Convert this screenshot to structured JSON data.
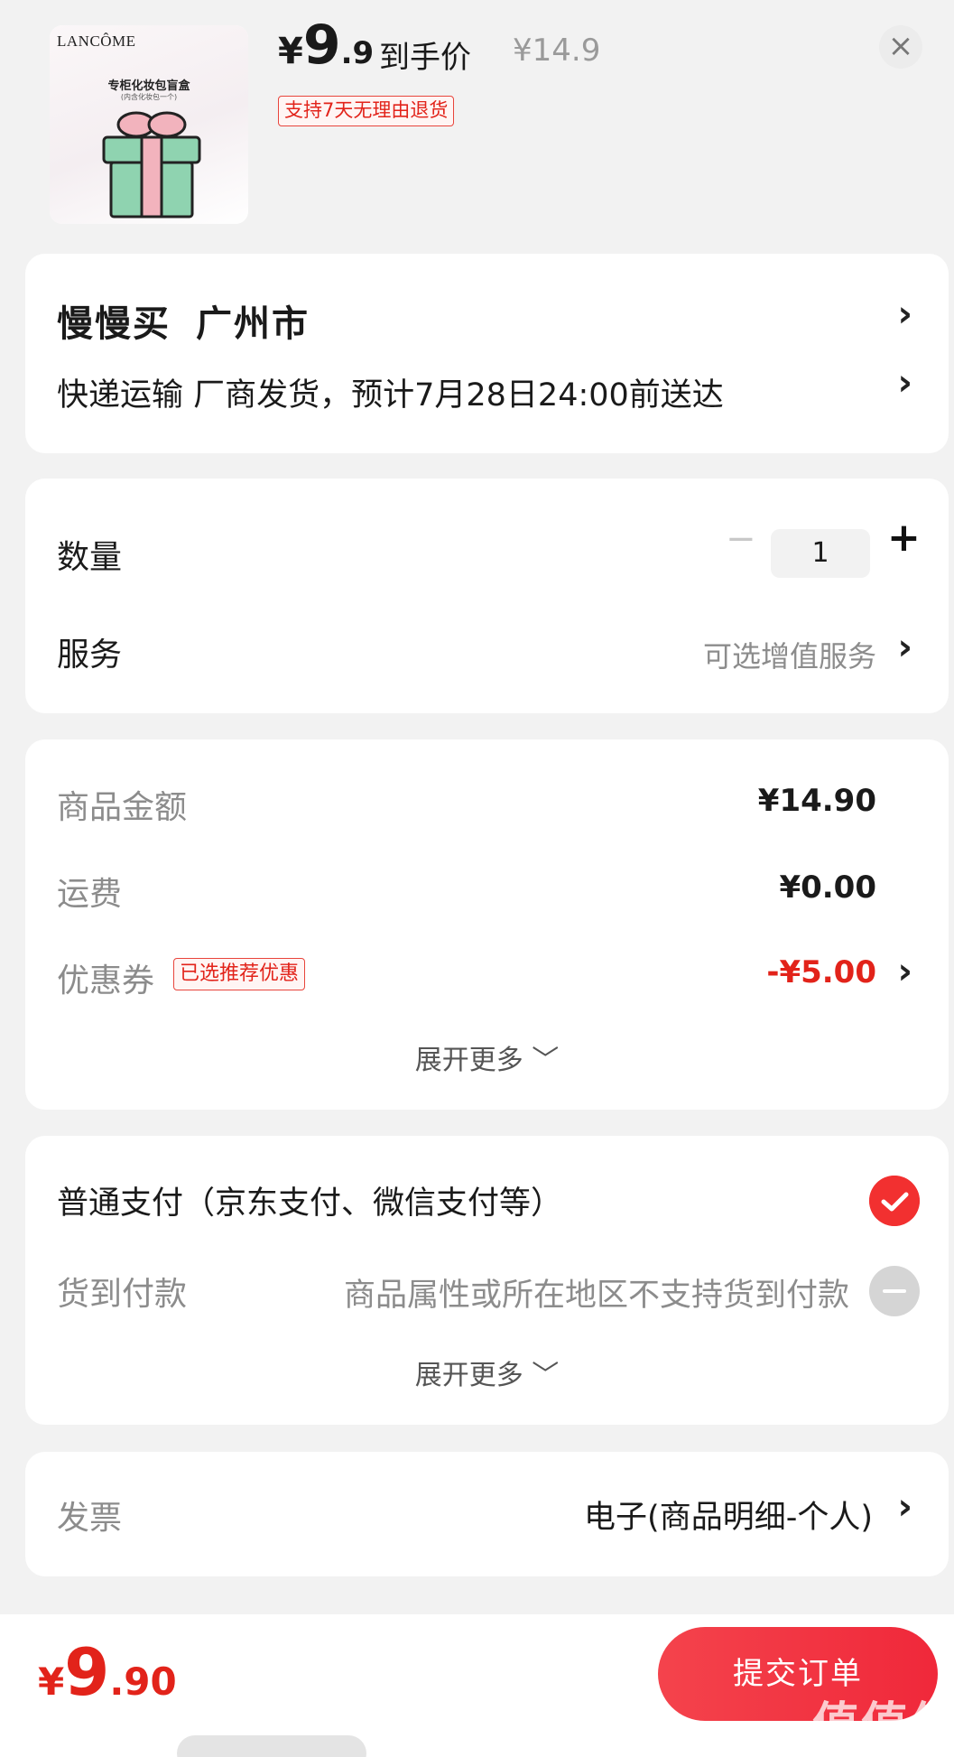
{
  "product": {
    "thumb_brand": "LANCÔME",
    "thumb_title": "专柜化妆包盲盒",
    "thumb_subtitle": "(内含化妆包一个)",
    "price_symbol": "¥",
    "price_int": "9",
    "price_dec": ".9",
    "price_label": "到手价",
    "original_price": "¥14.9",
    "return_badge": "支持7天无理由退货",
    "close_glyph": "×"
  },
  "address": {
    "name": "慢慢买",
    "city": "广州市",
    "shipping": "快递运输 厂商发货，预计7月28日24:00前送达",
    "chevron": "›"
  },
  "options": {
    "quantity_label": "数量",
    "quantity_value": "1",
    "minus_glyph": "−",
    "plus_glyph": "+",
    "service_label": "服务",
    "service_hint": "可选增值服务"
  },
  "summary": {
    "goods_label": "商品金额",
    "goods_amount": "¥14.90",
    "freight_label": "运费",
    "freight_amount": "¥0.00",
    "coupon_label": "优惠券",
    "coupon_badge": "已选推荐优惠",
    "coupon_amount": "-¥5.00",
    "expand_more": "展开更多 ﹀"
  },
  "payment": {
    "normal_label": "普通支付（京东支付、微信支付等）",
    "cod_label": "货到付款",
    "cod_reason": "商品属性或所在地区不支持货到付款",
    "expand_more": "展开更多 ﹀"
  },
  "invoice": {
    "label": "发票",
    "value": "电子(商品明细-个人)"
  },
  "footer": {
    "total_symbol": "¥",
    "total_int": "9",
    "total_dec": ".90",
    "submit_label": "提交订单",
    "watermark": "值值值",
    "watermark_url": "zhizhizhi.com"
  },
  "colors": {
    "accent_red": "#e2231a",
    "button_red": "#f0283a",
    "background": "#f2f2f2"
  },
  "icons": [
    "close-icon",
    "chevron-right-icon",
    "minus-icon",
    "plus-icon",
    "check-circle-icon",
    "disabled-circle-icon",
    "chevron-down-icon"
  ]
}
